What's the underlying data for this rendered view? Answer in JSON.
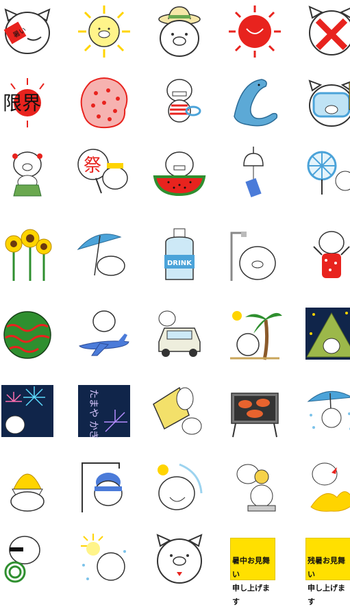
{
  "sticker_grid": {
    "columns": 5,
    "rows": 8,
    "stickers": [
      {
        "id": "pig-face-red-label",
        "text": "暑い"
      },
      {
        "id": "sun-pig"
      },
      {
        "id": "pig-straw-hat"
      },
      {
        "id": "red-sun-pig"
      },
      {
        "id": "pig-red-x-mask"
      },
      {
        "id": "genkai-text",
        "text": "限界"
      },
      {
        "id": "red-pattern-blob"
      },
      {
        "id": "pig-swimsuit-float"
      },
      {
        "id": "dolphin"
      },
      {
        "id": "pig-snorkel-mask"
      },
      {
        "id": "pig-hula-skirt"
      },
      {
        "id": "pig-matsuri-fan",
        "text": "祭"
      },
      {
        "id": "pig-watermelon-slice"
      },
      {
        "id": "wind-chime"
      },
      {
        "id": "electric-fan-pig"
      },
      {
        "id": "sunflowers-pig"
      },
      {
        "id": "pig-under-parasol"
      },
      {
        "id": "pig-drink-bottle",
        "text": "DRINK"
      },
      {
        "id": "pig-shower"
      },
      {
        "id": "pig-red-swimsuit"
      },
      {
        "id": "whole-watermelon"
      },
      {
        "id": "pig-airplane"
      },
      {
        "id": "pig-car"
      },
      {
        "id": "pig-palm-tree"
      },
      {
        "id": "pig-night-tent"
      },
      {
        "id": "fireworks-pig"
      },
      {
        "id": "tamaya-kagiya-fireworks",
        "text": "たまや かぎや"
      },
      {
        "id": "pig-yellow-flag"
      },
      {
        "id": "bbq-grill"
      },
      {
        "id": "pig-umbrella-rain"
      },
      {
        "id": "pig-shaved-ice"
      },
      {
        "id": "pig-suikawari-blindfold"
      },
      {
        "id": "pig-sunny-laugh"
      },
      {
        "id": "pig-fan-scale"
      },
      {
        "id": "pig-fire-burst"
      },
      {
        "id": "pig-mosquito-coil"
      },
      {
        "id": "pig-sun-sparkle"
      },
      {
        "id": "pig-face-red-mouth"
      },
      {
        "id": "shochu-omimai",
        "text": "暑中お見舞い\n申し上げます"
      },
      {
        "id": "zansho-omimai",
        "text": "残暑お見舞い\n申し上げます"
      }
    ]
  },
  "colors": {
    "outline": "#333333",
    "red": "#e8231e",
    "yellow": "#ffe000",
    "sky": "#4ba3d9",
    "navy": "#10254a",
    "green": "#2f8f2f"
  }
}
